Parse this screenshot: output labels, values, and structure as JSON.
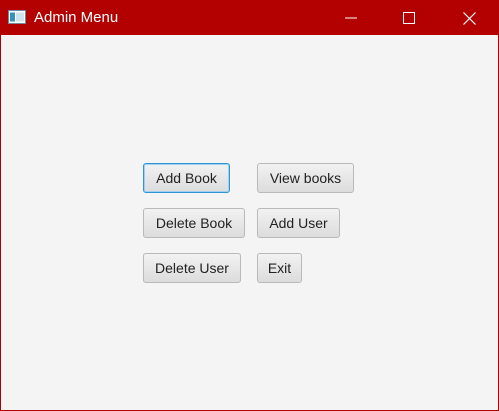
{
  "window": {
    "title": "Admin Menu",
    "icon": "java-app-icon",
    "controls": {
      "minimize": "minimize-icon",
      "maximize": "maximize-icon",
      "close": "close-icon"
    },
    "titlebar_color": "#b30000",
    "focus_color": "#2c96d6"
  },
  "menu": {
    "add_book": "Add Book",
    "view_books": "View books",
    "delete_book": "Delete Book",
    "add_user": "Add User",
    "delete_user": "Delete User",
    "exit": "Exit"
  }
}
